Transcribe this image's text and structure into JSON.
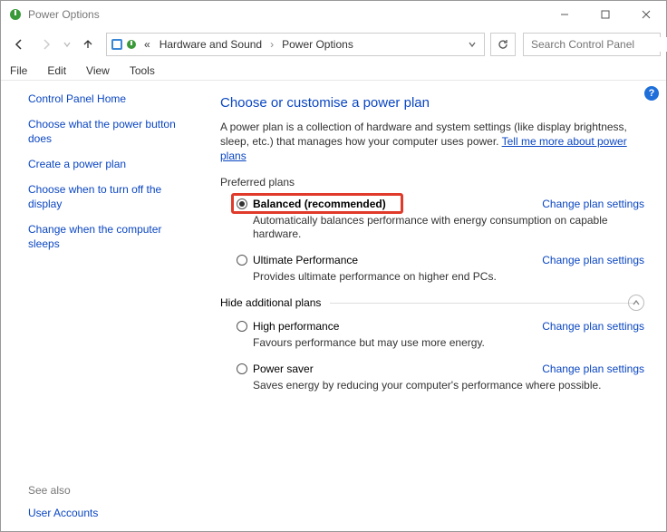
{
  "window": {
    "title": "Power Options"
  },
  "breadcrumb": {
    "prefix": "«",
    "part1": "Hardware and Sound",
    "part2": "Power Options"
  },
  "search": {
    "placeholder": "Search Control Panel"
  },
  "menu": {
    "file": "File",
    "edit": "Edit",
    "view": "View",
    "tools": "Tools"
  },
  "sidebar": {
    "home": "Control Panel Home",
    "links": [
      "Choose what the power button does",
      "Create a power plan",
      "Choose when to turn off the display",
      "Change when the computer sleeps"
    ],
    "see_also_label": "See also",
    "see_also_link": "User Accounts"
  },
  "content": {
    "title": "Choose or customise a power plan",
    "desc_pre": "A power plan is a collection of hardware and system settings (like display brightness, sleep, etc.) that manages how your computer uses power. ",
    "desc_link": "Tell me more about power plans",
    "preferred_label": "Preferred plans",
    "hide_label": "Hide additional plans",
    "change_link": "Change plan settings",
    "plans_preferred": [
      {
        "name": "Balanced (recommended)",
        "desc": "Automatically balances performance with energy consumption on capable hardware.",
        "checked": true
      },
      {
        "name": "Ultimate Performance",
        "desc": "Provides ultimate performance on higher end PCs.",
        "checked": false
      }
    ],
    "plans_hidden": [
      {
        "name": "High performance",
        "desc": "Favours performance but may use more energy.",
        "checked": false
      },
      {
        "name": "Power saver",
        "desc": "Saves energy by reducing your computer's performance where possible.",
        "checked": false
      }
    ]
  }
}
